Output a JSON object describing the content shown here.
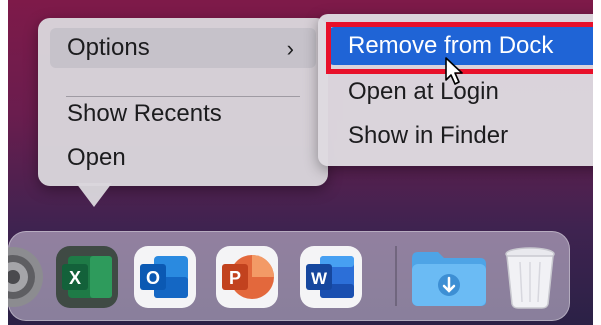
{
  "context_menu": {
    "items": [
      {
        "label": "Options",
        "submenu_indicator": "›"
      },
      {
        "label": "Show Recents"
      },
      {
        "label": "Open"
      }
    ]
  },
  "submenu": {
    "items": [
      {
        "label": "Remove from Dock",
        "selected": true
      },
      {
        "label": "Open at Login"
      },
      {
        "label": "Show in Finder"
      }
    ]
  },
  "colors": {
    "selection": "#1f64d6",
    "highlight_box": "#e8102a"
  },
  "dock": {
    "apps": [
      {
        "name": "system-settings-icon"
      },
      {
        "name": "excel-icon",
        "letter": "X"
      },
      {
        "name": "outlook-icon",
        "letter": "O"
      },
      {
        "name": "powerpoint-icon",
        "letter": "P"
      },
      {
        "name": "word-icon",
        "letter": "W"
      },
      {
        "name": "downloads-folder-icon"
      },
      {
        "name": "trash-icon"
      }
    ]
  }
}
